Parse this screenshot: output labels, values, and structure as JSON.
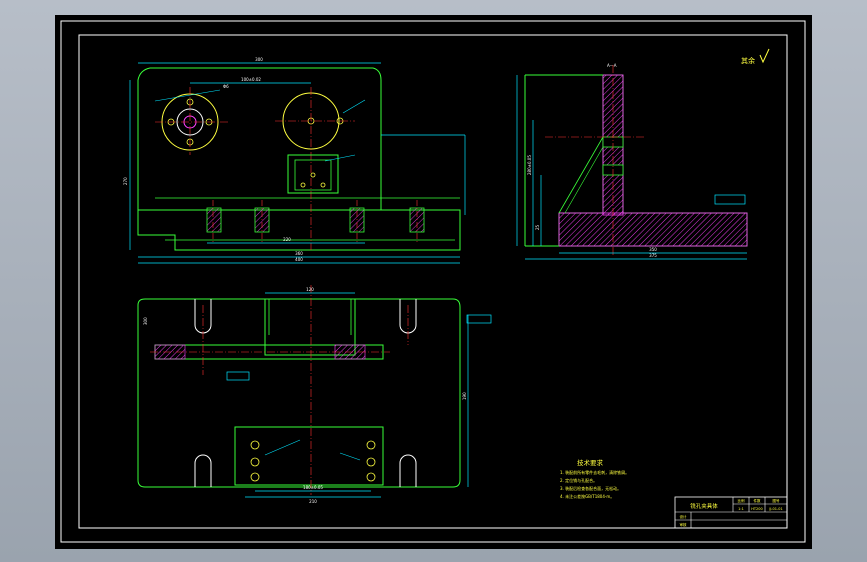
{
  "roughness_note": "其余",
  "tech_req": {
    "title": "技术要求",
    "items": [
      "1. 装配前所有零件去毛刺，清除铁屑。",
      "2. 定位销与孔配合。",
      "3. 装配后检查各配合面，无松动。",
      "4. 未注公差按GB/T1804-m。"
    ]
  },
  "title_block": {
    "name": "铣孔夹具体",
    "scale_label": "比例",
    "qty_label": "件数",
    "drawing_no_label": "图号",
    "scale": "1:1",
    "material": "HT200",
    "drawing_no": "JJ-01-01",
    "designer_label": "设计",
    "checker_label": "审核"
  },
  "section_label": "A—A",
  "dims": {
    "top_width": "300",
    "front_height": "270",
    "front_bottom": "360",
    "front_bottom2": "400",
    "front_mid": "220",
    "hole_dim": "Φ6",
    "hole_center": "100±0.02",
    "side_height": "280±0.05",
    "side_base": "350",
    "side_base2": "375",
    "side_thk": "25",
    "plan_width": "300",
    "plan_height": "190",
    "plan_bottom": "180±0.05",
    "plan_bottom2": "210",
    "plan_top": "120"
  }
}
